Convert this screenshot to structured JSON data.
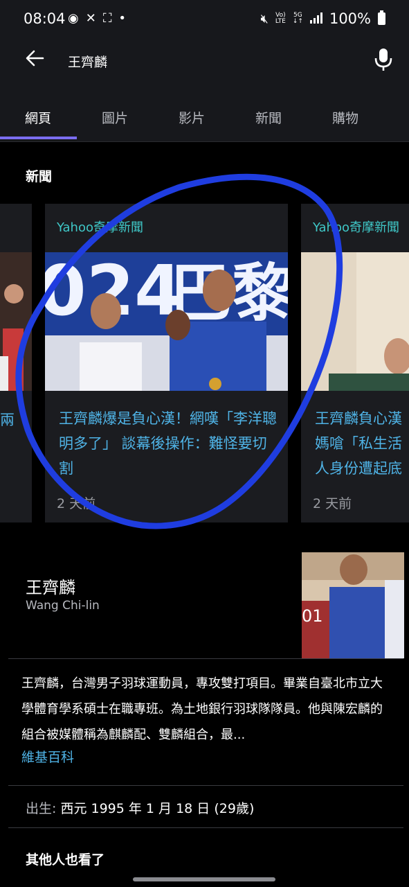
{
  "status": {
    "time": "08:04",
    "network_top": "Vo)",
    "network_bottom": "LTE",
    "gen_top": "5G",
    "battery": "100%"
  },
  "search": {
    "query": "王齊麟"
  },
  "tabs": [
    "網頁",
    "圖片",
    "影片",
    "新聞",
    "購物"
  ],
  "news": {
    "section_title": "新聞",
    "left_snippet": "兩",
    "cards": [
      {
        "source": "Yahoo奇摩新聞",
        "title": "王齊麟爆是負心漢！網嘆「李洋聰明多了」 談幕後操作：難怪要切割",
        "time": "2 天前"
      },
      {
        "source": "Yahoo奇摩新聞",
        "title": "王齊麟負心漢媽嗆「私生活人身份遭起底",
        "time": "2 天前"
      }
    ]
  },
  "knowledge": {
    "title": "王齊麟",
    "subtitle": "Wang Chi-lin",
    "description": "王齊麟，台灣男子羽球運動員，專攻雙打項目。畢業自臺北市立大學體育學系碩士在職專班。為土地銀行羽球隊隊員。他與陳宏麟的組合被媒體稱為麒麟配、雙麟組合，最...",
    "source_link": "維基百科",
    "born_label": "出生: ",
    "born_value": "西元 1995 年 1 月 18 日 (29歲)",
    "others_title": "其他人也看了"
  },
  "colors": {
    "accent": "#7b6df0",
    "link": "#4fb3e6",
    "source": "#3fc7c7",
    "annotation": "#1f3de0"
  }
}
